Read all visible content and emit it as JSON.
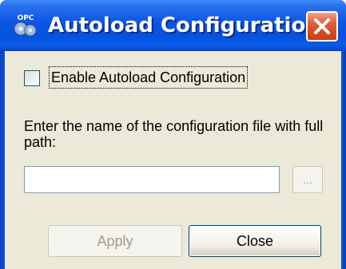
{
  "window": {
    "title": "Autoload Configuration",
    "icon_name": "opc-gear-icon",
    "icon_text": "OPC",
    "close_icon": "close-x-icon"
  },
  "form": {
    "enable_checkbox_label": "Enable Autoload Configuration",
    "enable_checked": false,
    "prompt_text": "Enter the name of the configuration file with full path:",
    "path_value": "",
    "browse_label": "...",
    "browse_enabled": false
  },
  "buttons": {
    "apply_label": "Apply",
    "apply_enabled": false,
    "close_label": "Close"
  },
  "colors": {
    "titlebar_blue": "#0a56e4",
    "dialog_face": "#ece9d8",
    "close_button_red": "#d44a22",
    "disabled_text": "#a19e8c"
  }
}
